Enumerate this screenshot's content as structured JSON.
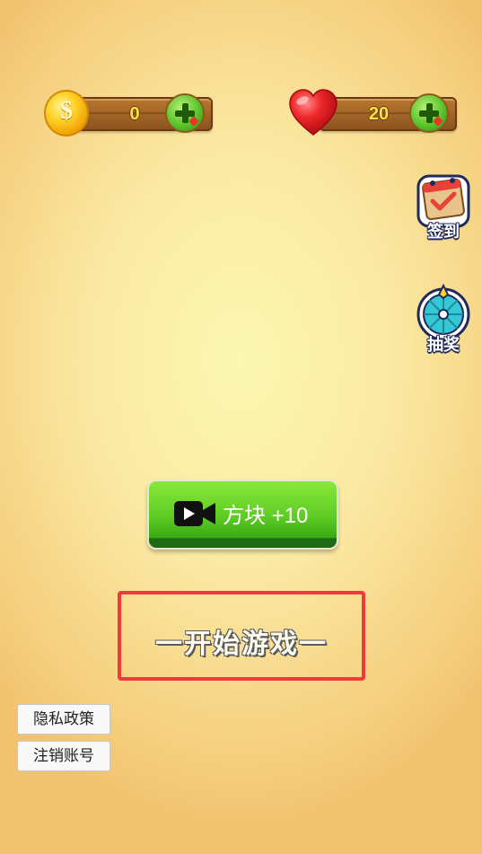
{
  "hud": {
    "coins": {
      "value": "0",
      "icon": "coin-icon"
    },
    "lives": {
      "value": "20",
      "icon": "heart-icon"
    }
  },
  "side_buttons": {
    "checkin_label": "签到",
    "lottery_label": "抽奖"
  },
  "video_button": {
    "label": "方块 +10",
    "icon": "video-camera-icon"
  },
  "start_game": {
    "label": "一开始游戏一",
    "highlight_color": "#ee3a3a"
  },
  "footer": {
    "privacy_label": "隐私政策",
    "deregister_label": "注销账号"
  }
}
